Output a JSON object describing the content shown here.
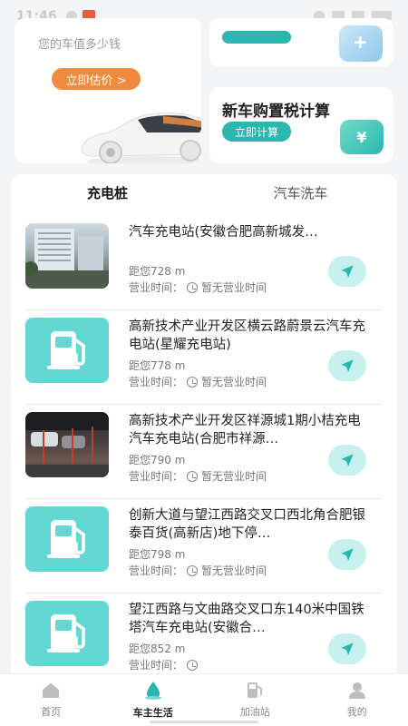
{
  "status_bar": {
    "time": "11:46"
  },
  "estimate_card": {
    "subtitle": "您的车值多少钱",
    "button_label": "立即估价 >"
  },
  "tax_card": {
    "title": "新车购置税计算",
    "button_label": "立即计算",
    "icon_symbol": "¥"
  },
  "tabs": [
    {
      "label": "充电桩",
      "active": true
    },
    {
      "label": "汽车洗车",
      "active": false
    }
  ],
  "stations": [
    {
      "name": "汽车充电站(安徽合肥高新城发…",
      "distance": "距您728 m",
      "hours_label": "营业时间：",
      "hours": "暂无营业时间",
      "thumb": "photo1"
    },
    {
      "name": "高新技术产业开发区横云路蔚景云汽车充电站(星耀充电站)",
      "distance": "距您778 m",
      "hours_label": "营业时间：",
      "hours": "暂无营业时间",
      "thumb": "pump"
    },
    {
      "name": "高新技术产业开发区祥源城1期小桔充电汽车充电站(合肥市祥源…",
      "distance": "距您790 m",
      "hours_label": "营业时间：",
      "hours": "暂无营业时间",
      "thumb": "photo2"
    },
    {
      "name": "创新大道与望江西路交叉口西北角合肥银泰百货(高新店)地下停…",
      "distance": "距您798 m",
      "hours_label": "营业时间：",
      "hours": "暂无营业时间",
      "thumb": "pump"
    },
    {
      "name": "望江西路与文曲路交叉口东140米中国铁塔汽车充电站(安徽合…",
      "distance": "距您852 m",
      "hours_label": "营业时间：",
      "hours": "",
      "thumb": "pump"
    }
  ],
  "bottom_nav": [
    {
      "label": "首页",
      "icon": "home-icon",
      "active": false
    },
    {
      "label": "车主生活",
      "icon": "drop-icon",
      "active": true
    },
    {
      "label": "加油站",
      "icon": "fuel-pump-icon",
      "active": false
    },
    {
      "label": "我的",
      "icon": "user-icon",
      "active": false
    }
  ],
  "colors": {
    "accent_teal": "#2ab7b0",
    "accent_orange": "#f08a3c",
    "nav_bg": "#c8f0ec"
  }
}
